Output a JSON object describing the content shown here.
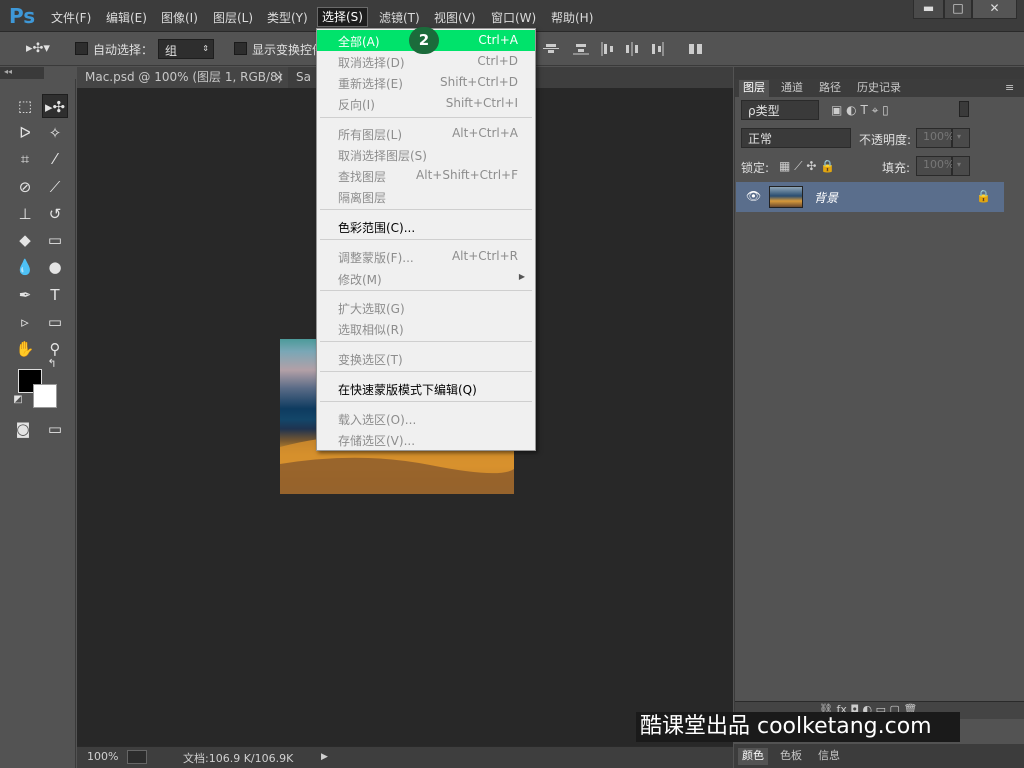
{
  "app": {
    "logo": "Ps"
  },
  "menubar": {
    "items": [
      "文件(F)",
      "编辑(E)",
      "图像(I)",
      "图层(L)",
      "类型(Y)",
      "选择(S)",
      "滤镜(T)",
      "视图(V)",
      "窗口(W)",
      "帮助(H)"
    ],
    "active": "选择(S)",
    "window_buttons": {
      "min": "▬",
      "max": "□",
      "close": "✕"
    }
  },
  "options": {
    "auto_select_label": "自动选择：",
    "auto_select_value": "组",
    "show_transform_label": "显示变换控件"
  },
  "tabs": {
    "doc1": "Mac.psd @ 100% (图层 1, RGB/8)",
    "doc1_close": "×",
    "doc2": "Sa"
  },
  "status": {
    "zoom": "100%",
    "doc_label": "文档:106.9 K/106.9K"
  },
  "select_menu": {
    "items": [
      {
        "label": "全部(A)",
        "shortcut": "Ctrl+A",
        "state": "highlight"
      },
      {
        "label": "取消选择(D)",
        "shortcut": "Ctrl+D",
        "state": "disabled"
      },
      {
        "label": "重新选择(E)",
        "shortcut": "Shift+Ctrl+D",
        "state": "disabled"
      },
      {
        "label": "反向(I)",
        "shortcut": "Shift+Ctrl+I",
        "state": "disabled"
      },
      {
        "label": "所有图层(L)",
        "shortcut": "Alt+Ctrl+A",
        "state": "disabled"
      },
      {
        "label": "取消选择图层(S)",
        "shortcut": "",
        "state": "disabled"
      },
      {
        "label": "查找图层",
        "shortcut": "Alt+Shift+Ctrl+F",
        "state": "disabled"
      },
      {
        "label": "隔离图层",
        "shortcut": "",
        "state": "disabled"
      },
      {
        "label": "色彩范围(C)...",
        "shortcut": "",
        "state": "enabled"
      },
      {
        "label": "调整蒙版(F)...",
        "shortcut": "Alt+Ctrl+R",
        "state": "disabled"
      },
      {
        "label": "修改(M)",
        "shortcut": "",
        "state": "disabled"
      },
      {
        "label": "扩大选取(G)",
        "shortcut": "",
        "state": "disabled"
      },
      {
        "label": "选取相似(R)",
        "shortcut": "",
        "state": "disabled"
      },
      {
        "label": "变换选区(T)",
        "shortcut": "",
        "state": "disabled"
      },
      {
        "label": "在快速蒙版模式下编辑(Q)",
        "shortcut": "",
        "state": "enabled"
      },
      {
        "label": "载入选区(O)...",
        "shortcut": "",
        "state": "disabled"
      },
      {
        "label": "存储选区(V)...",
        "shortcut": "",
        "state": "disabled"
      }
    ],
    "step_badge": "2"
  },
  "layers_panel": {
    "tabs": [
      "图层",
      "通道",
      "路径",
      "历史记录"
    ],
    "kind_filter": "ρ类型",
    "blend_mode": "正常",
    "opacity_label": "不透明度:",
    "opacity_value": "100%",
    "lock_label": "锁定:",
    "fill_label": "填充:",
    "fill_value": "100%",
    "layer_name": "背景"
  },
  "bottom_tabs": [
    "颜色",
    "色板",
    "信息"
  ],
  "watermark": "酷课堂出品 coolketang.com",
  "colors": {
    "highlight": "#00e36b",
    "layer_selected": "#5a6e8c",
    "accent": "#3e98d8"
  }
}
